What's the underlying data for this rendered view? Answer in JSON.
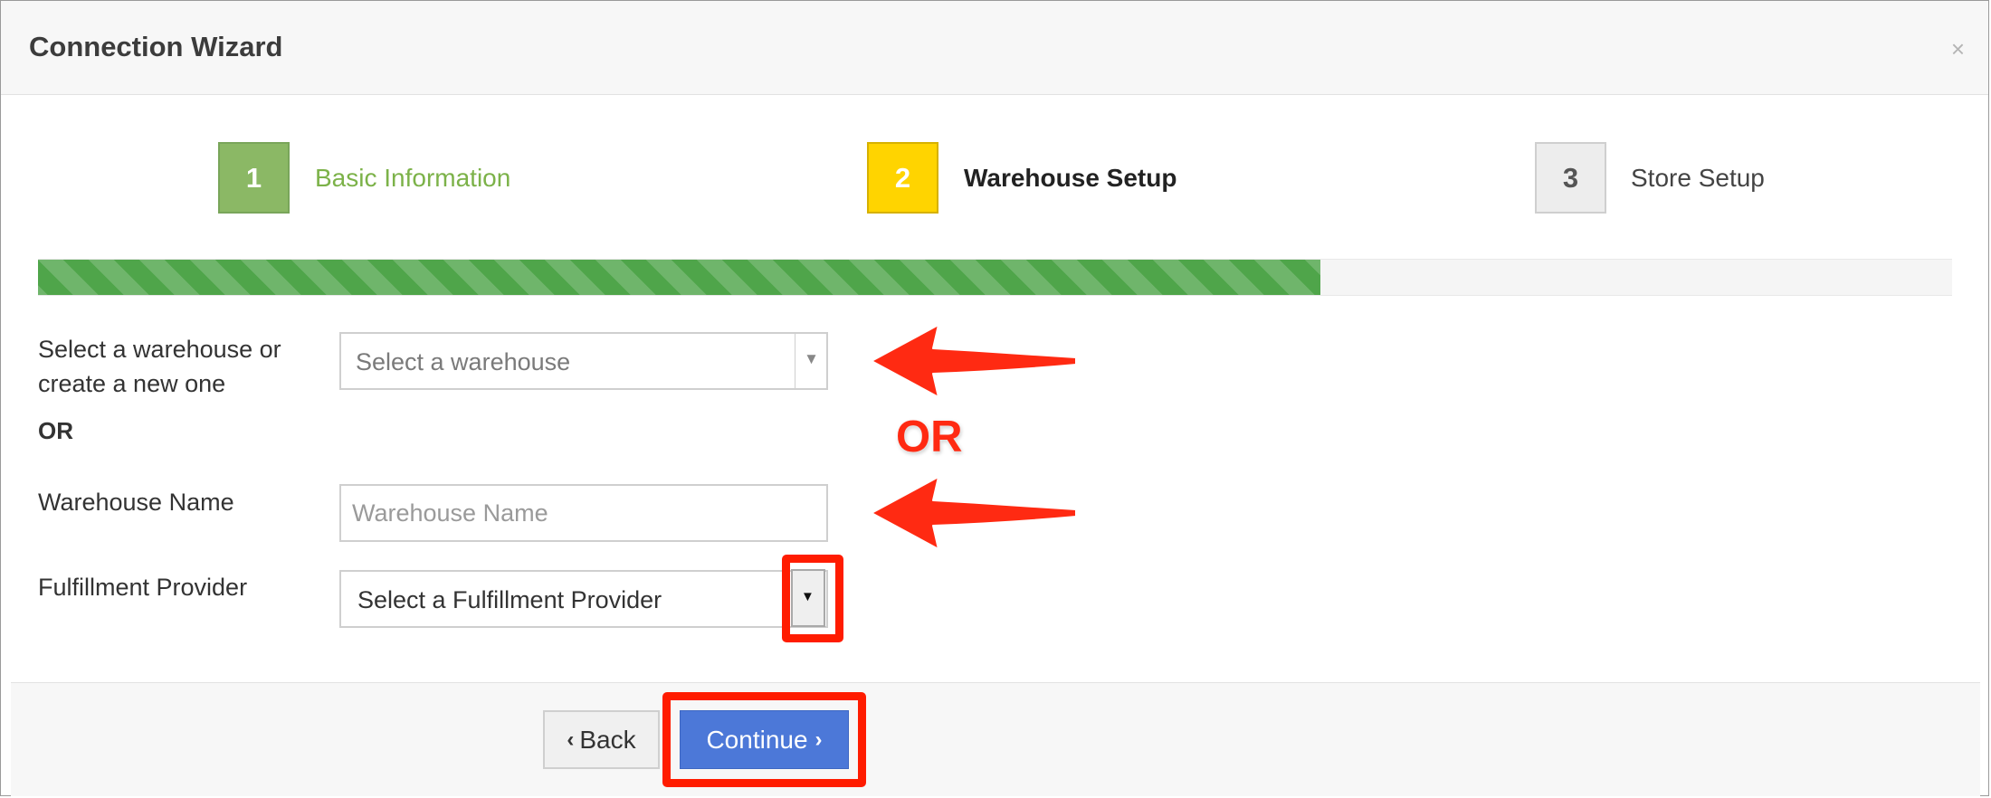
{
  "window": {
    "title": "Connection Wizard",
    "close_glyph": "×"
  },
  "steps": [
    {
      "number": "1",
      "label": "Basic Information",
      "state": "complete",
      "color": "#8bb865"
    },
    {
      "number": "2",
      "label": "Warehouse Setup",
      "state": "active",
      "color": "#ffd400"
    },
    {
      "number": "3",
      "label": "Store Setup",
      "state": "pending",
      "color": "#ededed"
    }
  ],
  "progress": {
    "percent": 67,
    "color": "#4fa54a"
  },
  "form": {
    "warehouse_select_label_line1": "Select a warehouse or",
    "warehouse_select_label_line2": "create a new one",
    "warehouse_select_value": "Select a warehouse",
    "or_label": "OR",
    "warehouse_name_label": "Warehouse Name",
    "warehouse_name_placeholder": "Warehouse Name",
    "fulfillment_label": "Fulfillment Provider",
    "fulfillment_value": "Select a Fulfillment Provider"
  },
  "annotations": {
    "or_text": "OR",
    "color": "#ff1c00"
  },
  "footer": {
    "back_label": "Back",
    "back_icon": "chevron-left-icon",
    "continue_label": "Continue",
    "continue_icon": "chevron-right-icon",
    "continue_color": "#4c78d8"
  }
}
